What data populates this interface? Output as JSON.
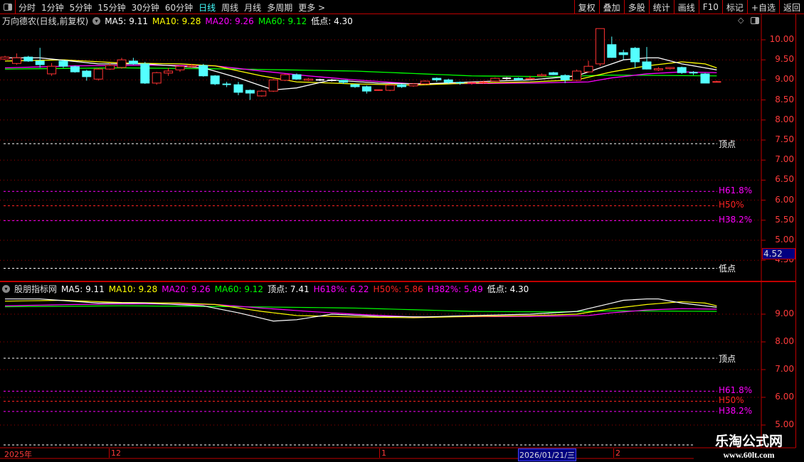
{
  "toolbar": {
    "periods": [
      "分时",
      "1分钟",
      "5分钟",
      "15分钟",
      "30分钟",
      "60分钟",
      "日线",
      "周线",
      "月线",
      "多周期",
      "更多 >"
    ],
    "active": "日线",
    "right_buttons": [
      "复权",
      "叠加",
      "多股",
      "统计",
      "画线",
      "F10",
      "标记",
      "+自选",
      "返回"
    ]
  },
  "main_legend": {
    "title": "万向德农(日线,前复权)",
    "ma5": "MA5: 9.11",
    "ma10": "MA10: 9.28",
    "ma20": "MA20: 9.26",
    "ma60": "MA60: 9.12",
    "low": "低点: 4.30"
  },
  "sub_legend": {
    "title": "股朋指标网",
    "ma5": "MA5: 9.11",
    "ma10": "MA10: 9.28",
    "ma20": "MA20: 9.26",
    "ma60": "MA60: 9.12",
    "top": "顶点: 7.41",
    "h618": "H618%: 6.22",
    "h50": "H50%: 5.86",
    "h382": "H382%: 5.49",
    "low": "低点: 4.30"
  },
  "levels": {
    "top_label": "顶点",
    "h618_label": "H61.8%",
    "h50_label": "H50%",
    "h382_label": "H38.2%",
    "low_label": "低点",
    "top": 7.41,
    "h618": 6.22,
    "h50": 5.86,
    "h382": 5.49,
    "low": 4.3
  },
  "main_axis": [
    "10.00",
    "9.50",
    "9.00",
    "8.50",
    "8.00",
    "7.50",
    "7.00",
    "6.50",
    "6.00",
    "5.50",
    "5.00",
    "4.50"
  ],
  "sub_axis": [
    "9.00",
    "8.00",
    "7.00",
    "6.00",
    "5.00"
  ],
  "current_price": "4.52",
  "time_axis": {
    "labels": [
      "2025年",
      "12",
      "1",
      "2"
    ],
    "cursor_date": "2026/01/21/三"
  },
  "watermark": {
    "name": "乐淘公式网",
    "url": "www.60lt.com"
  },
  "colors": {
    "up": "#ff3232",
    "down": "#54ffff",
    "ma5": "#ffffff",
    "ma10": "#ffff00",
    "ma20": "#ff00ff",
    "ma60": "#00ff00",
    "axis": "#ff3b3b",
    "border": "#c00000"
  },
  "chart_data": {
    "type": "candlestick",
    "ohlc": [
      [
        9.52,
        9.6,
        9.5,
        9.57
      ],
      [
        9.41,
        9.66,
        9.38,
        9.55
      ],
      [
        9.57,
        9.6,
        9.45,
        9.47
      ],
      [
        9.47,
        9.8,
        9.3,
        9.38
      ],
      [
        9.15,
        9.42,
        9.1,
        9.34
      ],
      [
        9.47,
        9.5,
        9.3,
        9.34
      ],
      [
        9.33,
        9.36,
        9.18,
        9.2
      ],
      [
        9.22,
        9.25,
        8.98,
        9.08
      ],
      [
        9.02,
        9.3,
        8.98,
        9.27
      ],
      [
        9.27,
        9.42,
        9.25,
        9.36
      ],
      [
        9.31,
        9.55,
        9.28,
        9.5
      ],
      [
        9.47,
        9.55,
        9.38,
        9.4
      ],
      [
        9.4,
        9.45,
        8.9,
        8.92
      ],
      [
        8.92,
        9.2,
        8.88,
        9.18
      ],
      [
        9.17,
        9.3,
        9.1,
        9.22
      ],
      [
        9.25,
        9.36,
        9.2,
        9.34
      ],
      [
        9.33,
        9.4,
        9.3,
        9.36
      ],
      [
        9.36,
        9.4,
        9.08,
        9.1
      ],
      [
        9.1,
        9.12,
        8.87,
        8.9
      ],
      [
        8.89,
        8.95,
        8.82,
        8.88
      ],
      [
        8.88,
        8.95,
        8.62,
        8.69
      ],
      [
        8.74,
        8.76,
        8.5,
        8.67
      ],
      [
        8.6,
        8.75,
        8.58,
        8.72
      ],
      [
        8.72,
        9.02,
        8.7,
        9.0
      ],
      [
        8.99,
        9.15,
        8.97,
        9.13
      ],
      [
        9.13,
        9.16,
        9.0,
        9.02
      ],
      [
        8.99,
        9.05,
        8.97,
        9.02
      ],
      [
        9.0,
        9.03,
        8.97,
        9.0
      ],
      [
        8.99,
        9.02,
        8.96,
        8.99
      ],
      [
        8.99,
        9.0,
        8.9,
        8.94
      ],
      [
        8.88,
        8.9,
        8.8,
        8.83
      ],
      [
        8.83,
        8.86,
        8.66,
        8.72
      ],
      [
        8.74,
        8.76,
        8.73,
        8.745
      ],
      [
        8.74,
        8.9,
        8.72,
        8.87
      ],
      [
        8.88,
        8.9,
        8.8,
        8.83
      ],
      [
        8.85,
        8.92,
        8.83,
        8.9
      ],
      [
        8.9,
        8.99,
        8.88,
        8.97
      ],
      [
        9.04,
        9.06,
        8.95,
        9.0
      ],
      [
        9.0,
        9.03,
        8.9,
        8.94
      ],
      [
        8.93,
        8.96,
        8.88,
        8.92
      ],
      [
        8.92,
        8.95,
        8.88,
        8.925
      ],
      [
        8.93,
        8.98,
        8.9,
        8.94
      ],
      [
        8.97,
        9.06,
        8.95,
        9.04
      ],
      [
        9.04,
        9.07,
        9.0,
        9.04
      ],
      [
        9.04,
        9.06,
        9.0,
        9.0
      ],
      [
        9.02,
        9.1,
        9.0,
        9.04
      ],
      [
        9.1,
        9.16,
        9.08,
        9.13
      ],
      [
        9.18,
        9.2,
        9.12,
        9.13
      ],
      [
        9.11,
        9.14,
        8.92,
        9.0
      ],
      [
        8.99,
        9.26,
        8.97,
        9.22
      ],
      [
        9.2,
        9.48,
        9.18,
        9.34
      ],
      [
        9.4,
        10.28,
        9.35,
        10.28
      ],
      [
        9.88,
        10.08,
        9.55,
        9.56
      ],
      [
        9.68,
        9.75,
        9.5,
        9.63
      ],
      [
        9.79,
        9.82,
        9.3,
        9.45
      ],
      [
        9.45,
        9.82,
        9.26,
        9.27
      ],
      [
        9.25,
        9.32,
        9.22,
        9.28
      ],
      [
        9.28,
        9.32,
        9.26,
        9.31
      ],
      [
        9.31,
        9.33,
        9.15,
        9.18
      ],
      [
        9.18,
        9.22,
        9.12,
        9.18
      ],
      [
        9.15,
        9.17,
        8.92,
        8.92
      ],
      [
        8.94,
        8.98,
        8.94,
        8.95
      ]
    ],
    "ma": {
      "ma5": [
        [
          0,
          9.55
        ],
        [
          3,
          9.55
        ],
        [
          8,
          9.4
        ],
        [
          12,
          9.4
        ],
        [
          17,
          9.3
        ],
        [
          20,
          9.05
        ],
        [
          23,
          8.75
        ],
        [
          25,
          8.8
        ],
        [
          28,
          9.0
        ],
        [
          32,
          8.92
        ],
        [
          36,
          8.9
        ],
        [
          40,
          8.95
        ],
        [
          45,
          9.0
        ],
        [
          49,
          9.1
        ],
        [
          51,
          9.3
        ],
        [
          53,
          9.5
        ],
        [
          55,
          9.55
        ],
        [
          56,
          9.55
        ],
        [
          58,
          9.4
        ],
        [
          61,
          9.25
        ]
      ],
      "ma10": [
        [
          0,
          9.47
        ],
        [
          5,
          9.5
        ],
        [
          10,
          9.42
        ],
        [
          15,
          9.4
        ],
        [
          18,
          9.35
        ],
        [
          22,
          9.1
        ],
        [
          25,
          8.95
        ],
        [
          30,
          8.9
        ],
        [
          35,
          8.87
        ],
        [
          40,
          8.92
        ],
        [
          45,
          8.95
        ],
        [
          49,
          9.0
        ],
        [
          52,
          9.2
        ],
        [
          55,
          9.35
        ],
        [
          58,
          9.45
        ],
        [
          60,
          9.4
        ],
        [
          61,
          9.3
        ]
      ],
      "ma20": [
        [
          0,
          9.3
        ],
        [
          6,
          9.35
        ],
        [
          12,
          9.37
        ],
        [
          18,
          9.35
        ],
        [
          22,
          9.22
        ],
        [
          26,
          9.1
        ],
        [
          30,
          9.0
        ],
        [
          35,
          8.9
        ],
        [
          45,
          8.92
        ],
        [
          50,
          8.95
        ],
        [
          52,
          9.05
        ],
        [
          55,
          9.15
        ],
        [
          58,
          9.2
        ],
        [
          61,
          9.18
        ]
      ],
      "ma60": [
        [
          0,
          9.27
        ],
        [
          10,
          9.3
        ],
        [
          20,
          9.27
        ],
        [
          30,
          9.22
        ],
        [
          40,
          9.1
        ],
        [
          47,
          9.08
        ],
        [
          52,
          9.12
        ],
        [
          61,
          9.1
        ]
      ]
    },
    "ylim_main": [
      4.3,
      10.35
    ],
    "ylim_sub": [
      4.9,
      9.5
    ]
  }
}
